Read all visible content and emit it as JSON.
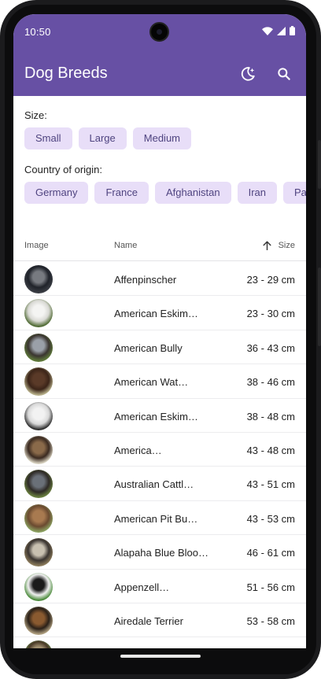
{
  "status": {
    "time": "10:50",
    "icons": [
      "wifi-icon",
      "signal-icon",
      "battery-icon"
    ]
  },
  "app_bar": {
    "title": "Dog Breeds",
    "actions": [
      "theme-toggle-icon",
      "search-icon"
    ],
    "color": "#6750a4"
  },
  "filters": {
    "size_label": "Size:",
    "sizes": [
      "Small",
      "Large",
      "Medium"
    ],
    "country_label": "Country of origin:",
    "countries": [
      "Germany",
      "France",
      "Afghanistan",
      "Iran",
      "Pa"
    ],
    "chip_color": "#e8def8"
  },
  "table": {
    "headers": {
      "image": "Image",
      "name": "Name",
      "size": "Size"
    },
    "sort": {
      "column": "size",
      "direction": "ascending",
      "icon": "arrow-up-icon"
    },
    "rows": [
      {
        "name": "Affenpinscher",
        "size": "23 - 29 cm",
        "colors": [
          "#3a3d44",
          "#777a80",
          "#20232a"
        ]
      },
      {
        "name": "American Eskim…",
        "size": "23 - 30 cm",
        "colors": [
          "#4f6a33",
          "#f4f4f2",
          "#d9d9d4"
        ]
      },
      {
        "name": "American Bully",
        "size": "36 - 43 cm",
        "colors": [
          "#5f7a3a",
          "#9aa0a8",
          "#3a3530"
        ]
      },
      {
        "name": "American Wat…",
        "size": "38 - 46 cm",
        "colors": [
          "#b7b08a",
          "#5a3a28",
          "#3b2418"
        ]
      },
      {
        "name": "American Eskim…",
        "size": "38 - 48 cm",
        "colors": [
          "#2b2b2b",
          "#f2f2f2",
          "#d8d8d8"
        ]
      },
      {
        "name": "America…",
        "size": "43 - 48 cm",
        "colors": [
          "#d8d2c0",
          "#8a6a4a",
          "#3a2a20"
        ]
      },
      {
        "name": "Australian Cattl…",
        "size": "43 - 51 cm",
        "colors": [
          "#6a8040",
          "#6a7078",
          "#2e2a26"
        ]
      },
      {
        "name": "American Pit Bu…",
        "size": "43 - 53 cm",
        "colors": [
          "#8aa060",
          "#a87a50",
          "#6a4a30"
        ]
      },
      {
        "name": "Alapaha Blue Bloo…",
        "size": "46 - 61 cm",
        "colors": [
          "#8a7a5a",
          "#c8c0b0",
          "#3a3430"
        ]
      },
      {
        "name": "Appenzell…",
        "size": "51 - 56 cm",
        "colors": [
          "#4a8a3a",
          "#1a1a1a",
          "#f0f0f0"
        ]
      },
      {
        "name": "Airedale Terrier",
        "size": "53 - 58 cm",
        "colors": [
          "#b0a080",
          "#8a5a30",
          "#2a2018"
        ]
      },
      {
        "name": "",
        "size": "",
        "colors": [
          "#6a9a50",
          "#a09070",
          "#4a3a28"
        ]
      }
    ]
  }
}
